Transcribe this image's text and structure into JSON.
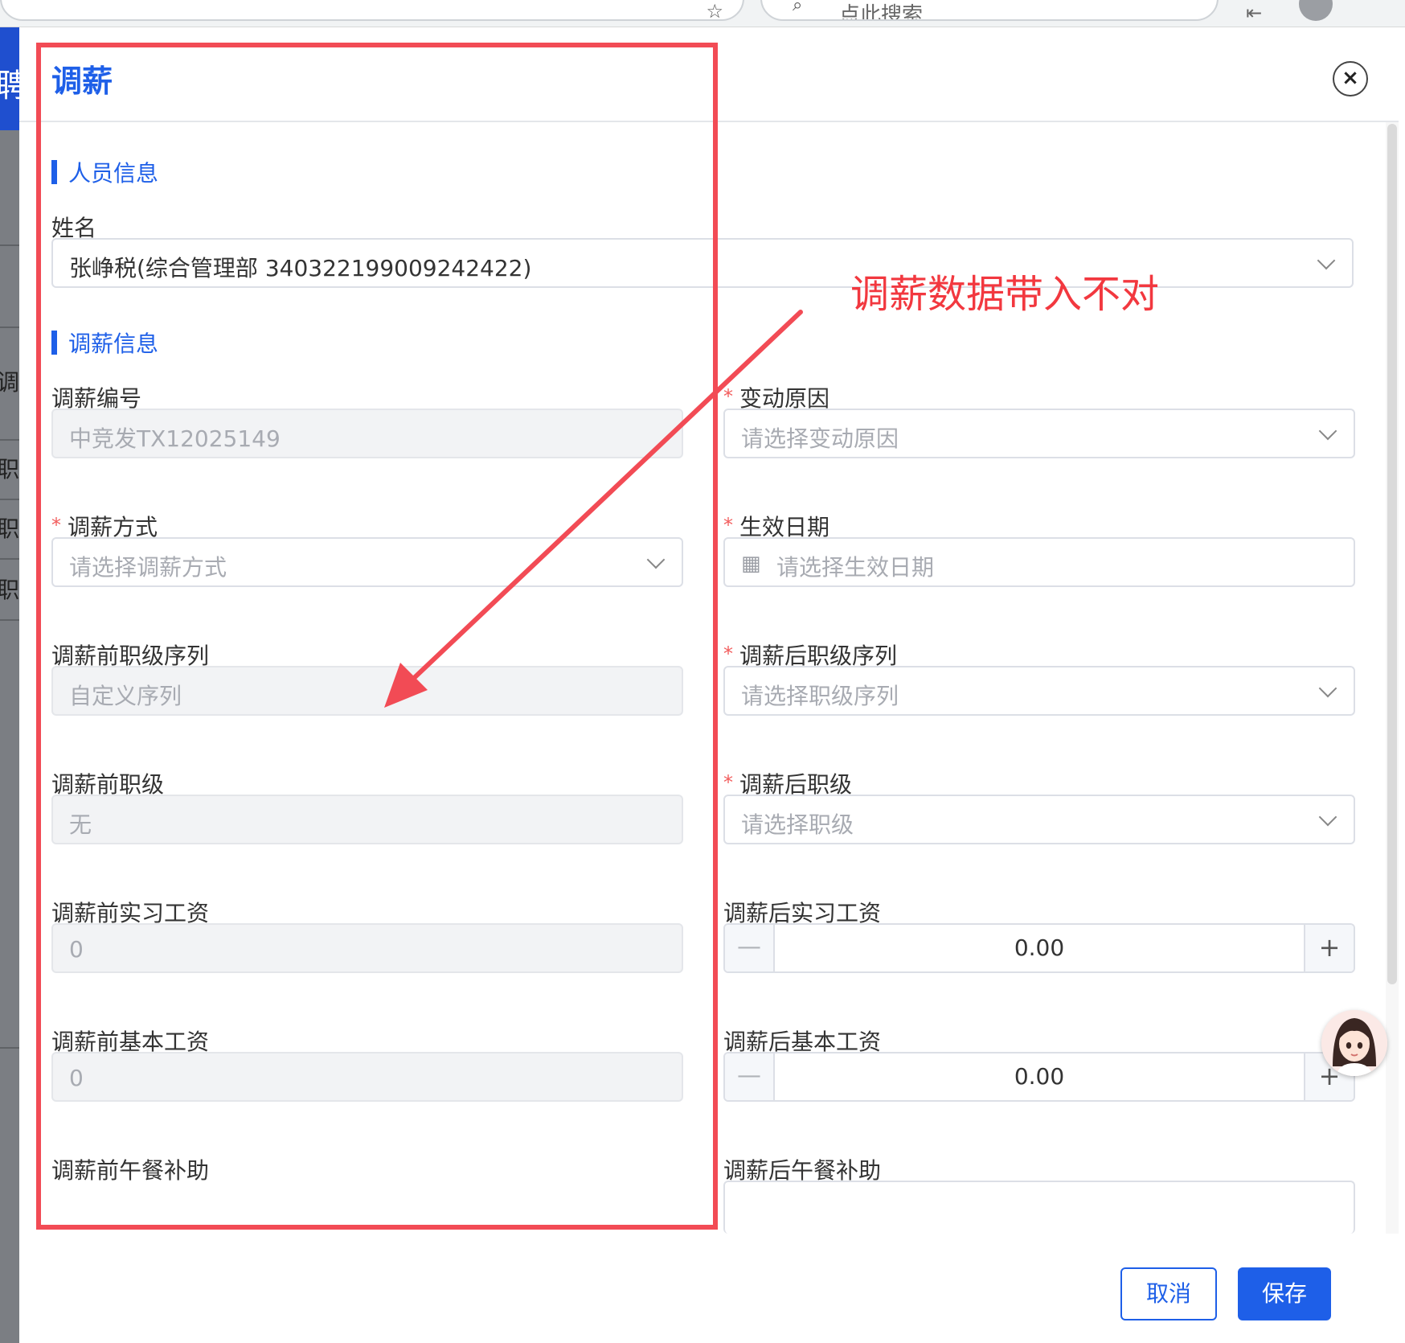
{
  "browser": {
    "search_placeholder": "点此搜索"
  },
  "background": {
    "nav_char": "聘",
    "side_labels": [
      "调",
      "职",
      "职",
      "职"
    ]
  },
  "dialog": {
    "title": "调薪",
    "close_symbol": "×"
  },
  "section_person": {
    "title": "人员信息",
    "name_label": "姓名",
    "name_value": "张峥税(综合管理部 340322199009242422)"
  },
  "section_salary": {
    "title": "调薪信息",
    "fields": {
      "number_label": "调薪编号",
      "number_value": "中竞发TX12025149",
      "reason_label": "变动原因",
      "reason_placeholder": "请选择变动原因",
      "method_label": "调薪方式",
      "method_placeholder": "请选择调薪方式",
      "effective_label": "生效日期",
      "effective_placeholder": "请选择生效日期",
      "before_series_label": "调薪前职级序列",
      "before_series_value": "自定义序列",
      "after_series_label": "调薪后职级序列",
      "after_series_placeholder": "请选择职级序列",
      "before_level_label": "调薪前职级",
      "before_level_value": "无",
      "after_level_label": "调薪后职级",
      "after_level_placeholder": "请选择职级",
      "before_intern_label": "调薪前实习工资",
      "before_intern_value": "0",
      "after_intern_label": "调薪后实习工资",
      "after_intern_value": "0.00",
      "before_basic_label": "调薪前基本工资",
      "before_basic_value": "0",
      "after_basic_label": "调薪后基本工资",
      "after_basic_value": "0.00",
      "before_lunch_label": "调薪前午餐补助",
      "after_lunch_label": "调薪后午餐补助"
    },
    "required_mark": "*",
    "stepper_minus": "—",
    "stepper_plus": "+"
  },
  "footer": {
    "cancel_label": "取消",
    "save_label": "保存"
  },
  "annotation": {
    "note": "调薪数据带入不对",
    "color": "#f24b55"
  },
  "colors": {
    "accent": "#1e5fe8",
    "required": "#f25d5d"
  }
}
